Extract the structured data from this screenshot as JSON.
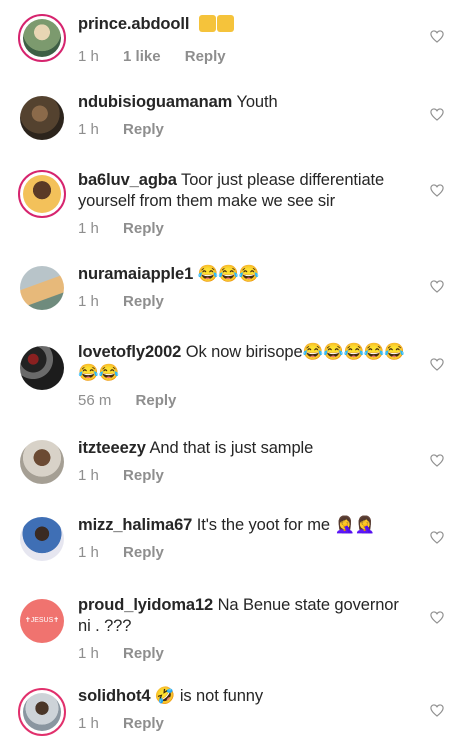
{
  "comments": [
    {
      "username": "prince.abdooll",
      "text": "👆👆",
      "time": "1 h",
      "likes": "1 like",
      "reply": "Reply"
    },
    {
      "username": "ndubisioguamanam",
      "text": "Youth",
      "time": "1 h",
      "reply": "Reply"
    },
    {
      "username": "ba6luv_agba",
      "text": "Toor just please differentiate yourself from them make we see sir",
      "time": "1 h",
      "reply": "Reply"
    },
    {
      "username": "nuramaiapple1",
      "text": "😂😂😂",
      "time": "1 h",
      "reply": "Reply"
    },
    {
      "username": "lovetofly2002",
      "text": "Ok now birisope😂😂😂😂😂😂😂",
      "time": "56 m",
      "reply": "Reply"
    },
    {
      "username": "itzteeezy",
      "text": "And that is just sample",
      "time": "1 h",
      "reply": "Reply"
    },
    {
      "username": "mizz_halima67",
      "text": "It's the yoot for me 🤦‍♀️🤦‍♀️",
      "time": "1 h",
      "reply": "Reply"
    },
    {
      "username": "proud_lyidoma12",
      "text": "Na Benue state governor ni . ???",
      "time": "1 h",
      "reply": "Reply",
      "avatar_text": "✝JESUS✝"
    },
    {
      "username": "solidhot4",
      "text": "🤣 is not funny",
      "time": "1 h",
      "reply": "Reply"
    }
  ],
  "colors": {
    "text": "#262626",
    "muted": "#8e8e8e",
    "story_ring": "#d6246e",
    "emoji": "#f5c33b"
  },
  "icons": {
    "like": "heart-outline-icon"
  }
}
